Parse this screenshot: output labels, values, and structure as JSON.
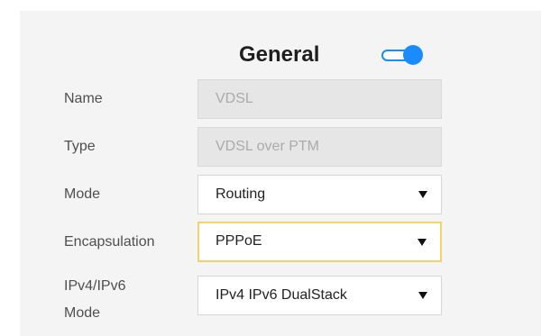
{
  "section": {
    "title": "General",
    "enabled": true
  },
  "fields": {
    "name": {
      "label": "Name",
      "value": "VDSL"
    },
    "type": {
      "label": "Type",
      "value": "VDSL over PTM"
    },
    "mode": {
      "label": "Mode",
      "value": "Routing"
    },
    "encapsulation": {
      "label": "Encapsulation",
      "value": "PPPoE"
    },
    "ip_mode": {
      "label_line1": "IPv4/IPv6",
      "label_line2": "Mode",
      "value": "IPv4 IPv6 DualStack"
    }
  },
  "colors": {
    "toggle_accent": "#1a8cff",
    "focus_border": "#f2d36b"
  }
}
